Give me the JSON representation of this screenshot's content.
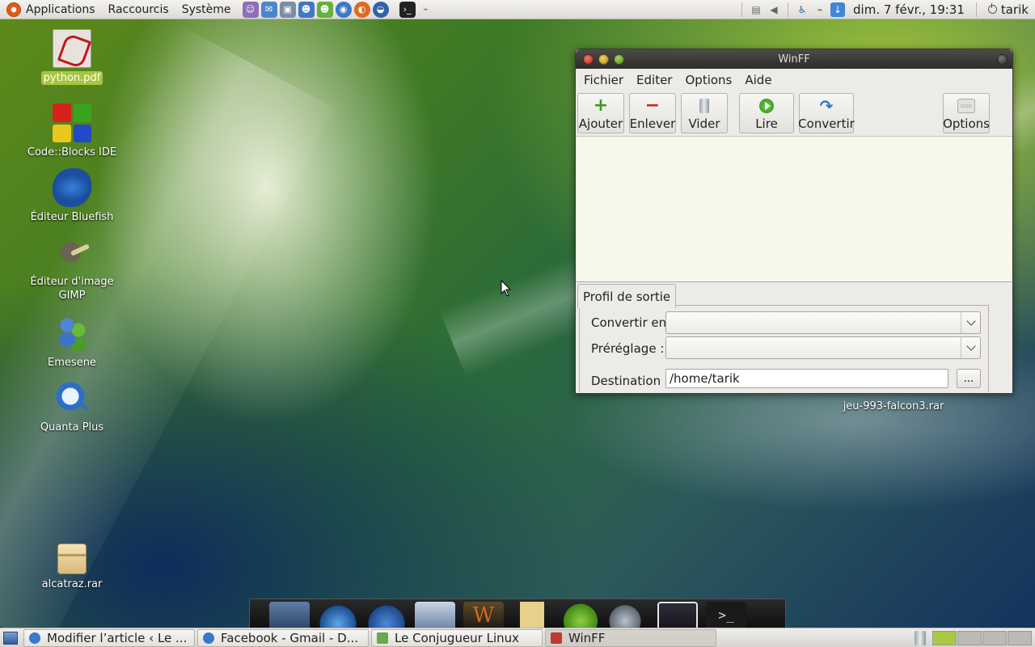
{
  "top_panel": {
    "menus": [
      "Applications",
      "Raccourcis",
      "Système"
    ],
    "launchers": [
      {
        "name": "pidgin-icon",
        "color": "#8c6fb8"
      },
      {
        "name": "mail-icon",
        "color": "#4b86cc"
      },
      {
        "name": "screenshot-icon",
        "color": "#7a8ea8"
      },
      {
        "name": "contacts-icon",
        "color": "#3f79c6"
      },
      {
        "name": "emesene-icon",
        "color": "#62b33a"
      },
      {
        "name": "chrome-icon",
        "color": "#3a78c8"
      },
      {
        "name": "firefox-icon",
        "color": "#e06a1f"
      },
      {
        "name": "thunderbird-icon",
        "color": "#2f63a8"
      },
      {
        "name": "terminal-icon",
        "color": "#222222"
      },
      {
        "name": "network-manager-icon",
        "color": "#888888"
      }
    ],
    "clock": "dim.  7 févr., 19:31",
    "user": "tarik"
  },
  "desktop_icons": [
    {
      "label": "python.pdf"
    },
    {
      "label": "Code::Blocks IDE"
    },
    {
      "label": "Éditeur Bluefish"
    },
    {
      "label": "Éditeur d'image GIMP"
    },
    {
      "label": "Emesene"
    },
    {
      "label": "Quanta Plus"
    },
    {
      "label": "alcatraz.rar"
    },
    {
      "label": "jeu-993-falcon3.rar"
    }
  ],
  "window": {
    "title": "WinFF",
    "menu": [
      "Fichier",
      "Editer",
      "Options",
      "Aide"
    ],
    "toolbar": {
      "add": "Ajouter",
      "remove": "Enlever",
      "clear": "Vider",
      "play": "Lire",
      "convert": "Convertir",
      "options": "Options"
    },
    "tab": "Profil de sortie",
    "convert_label": "Convertir en",
    "preset_label": "Préréglage :",
    "destination_label": "Destination",
    "destination_value": "/home/tarik",
    "browse": "..."
  },
  "taskbar": [
    {
      "label": "Modifier l’article ‹ Le ...",
      "icon_color": "#3a78c8",
      "active": false
    },
    {
      "label": "Facebook - Gmail - D...",
      "icon_color": "#3a78c8",
      "active": false
    },
    {
      "label": "Le Conjugueur Linux",
      "icon_color": "#6aa84f",
      "active": false
    },
    {
      "label": "WinFF",
      "icon_color": "#c0392b",
      "active": true
    }
  ],
  "colors": {
    "selection": "#a7c53f",
    "accent": "#e05a1a"
  }
}
